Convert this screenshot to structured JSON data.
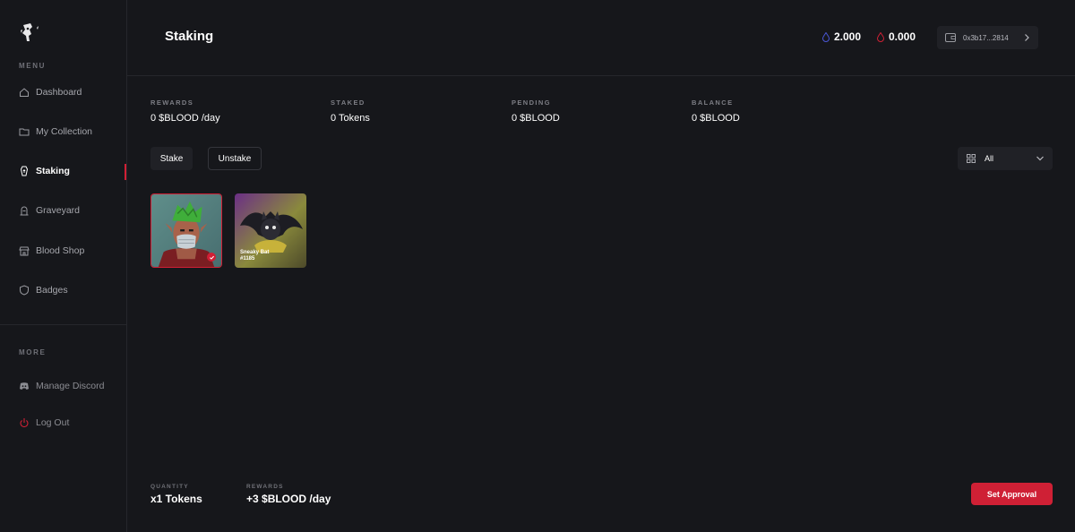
{
  "sidebar": {
    "menu_label": "MENU",
    "items": [
      {
        "label": "Dashboard",
        "icon": "home-icon"
      },
      {
        "label": "My Collection",
        "icon": "folder-icon"
      },
      {
        "label": "Staking",
        "icon": "coffin-icon",
        "active": true
      },
      {
        "label": "Graveyard",
        "icon": "tombstone-icon"
      },
      {
        "label": "Blood Shop",
        "icon": "shop-icon"
      },
      {
        "label": "Badges",
        "icon": "shield-icon"
      }
    ],
    "more_label": "MORE",
    "more_items": [
      {
        "label": "Manage Discord",
        "icon": "discord-icon"
      },
      {
        "label": "Log Out",
        "icon": "power-icon"
      }
    ]
  },
  "header": {
    "title": "Staking",
    "balance_a": "2.000",
    "balance_b": "0.000",
    "wallet": "0x3b17...2814"
  },
  "stats": [
    {
      "label": "REWARDS",
      "value": "0 $BLOOD /day"
    },
    {
      "label": "STAKED",
      "value": "0 Tokens"
    },
    {
      "label": "PENDING",
      "value": "0 $BLOOD"
    },
    {
      "label": "BALANCE",
      "value": "0 $BLOOD"
    }
  ],
  "actions": {
    "stake": "Stake",
    "unstake": "Unstake",
    "filter": "All"
  },
  "nfts": [
    {
      "caption": "",
      "selected": true
    },
    {
      "caption_line1": "Sneaky Bat",
      "caption_line2": "#1185",
      "selected": false
    }
  ],
  "footer": {
    "quantity_label": "QUANTITY",
    "quantity_value": "x1 Tokens",
    "rewards_label": "REWARDS",
    "rewards_value": "+3 $BLOOD /day",
    "approval_button": "Set Approval"
  },
  "colors": {
    "accent": "#cf2035",
    "background": "#16171b",
    "panel": "#202126"
  }
}
